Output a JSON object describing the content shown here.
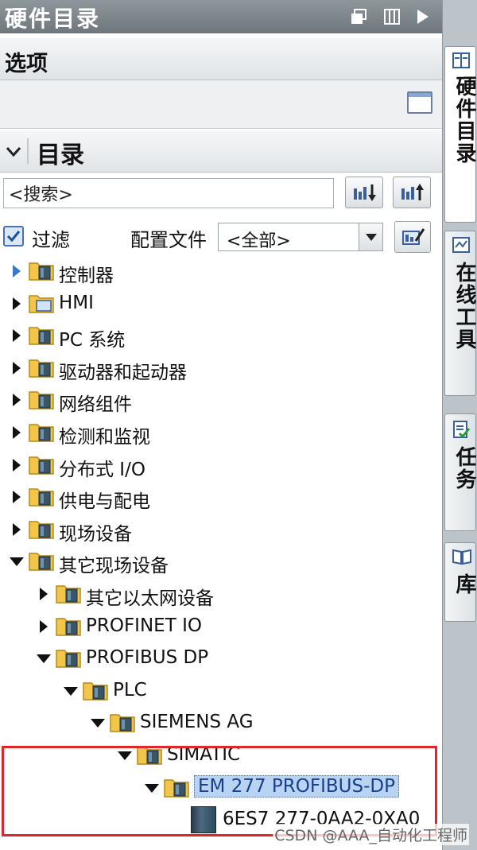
{
  "window": {
    "title": "硬件目录"
  },
  "options": {
    "label": "选项"
  },
  "catalog": {
    "label": "目录"
  },
  "search": {
    "value": "<搜索>"
  },
  "filter": {
    "label": "过滤",
    "checked": true
  },
  "profile": {
    "label": "配置文件",
    "value": "<全部>"
  },
  "tree": {
    "items": [
      {
        "label": "控制器"
      },
      {
        "label": "HMI"
      },
      {
        "label": "PC 系统"
      },
      {
        "label": "驱动器和起动器"
      },
      {
        "label": "网络组件"
      },
      {
        "label": "检测和监视"
      },
      {
        "label": "分布式 I/O"
      },
      {
        "label": "供电与配电"
      },
      {
        "label": "现场设备"
      },
      {
        "label": "其它现场设备"
      },
      {
        "label": "其它以太网设备"
      },
      {
        "label": "PROFINET IO"
      },
      {
        "label": "PROFIBUS DP"
      },
      {
        "label": "PLC"
      },
      {
        "label": "SIEMENS AG"
      },
      {
        "label": "SIMATIC"
      },
      {
        "label": "EM 277 PROFIBUS-DP"
      },
      {
        "label": "6ES7 277-0AA2-0XA0"
      }
    ]
  },
  "side_tabs": [
    {
      "label": "硬件目录",
      "icon": "catalog-icon"
    },
    {
      "label": "在线工具",
      "icon": "online-tools-icon"
    },
    {
      "label": "任务",
      "icon": "tasks-icon"
    },
    {
      "label": "库",
      "icon": "library-icon"
    }
  ],
  "watermark": "CSDN @AAA_自动化工程师",
  "colors": {
    "title_bar": "#7d868b",
    "selection": "#e0262a",
    "highlight": "#b9d3f2",
    "expander_blue": "#3a78d0"
  }
}
